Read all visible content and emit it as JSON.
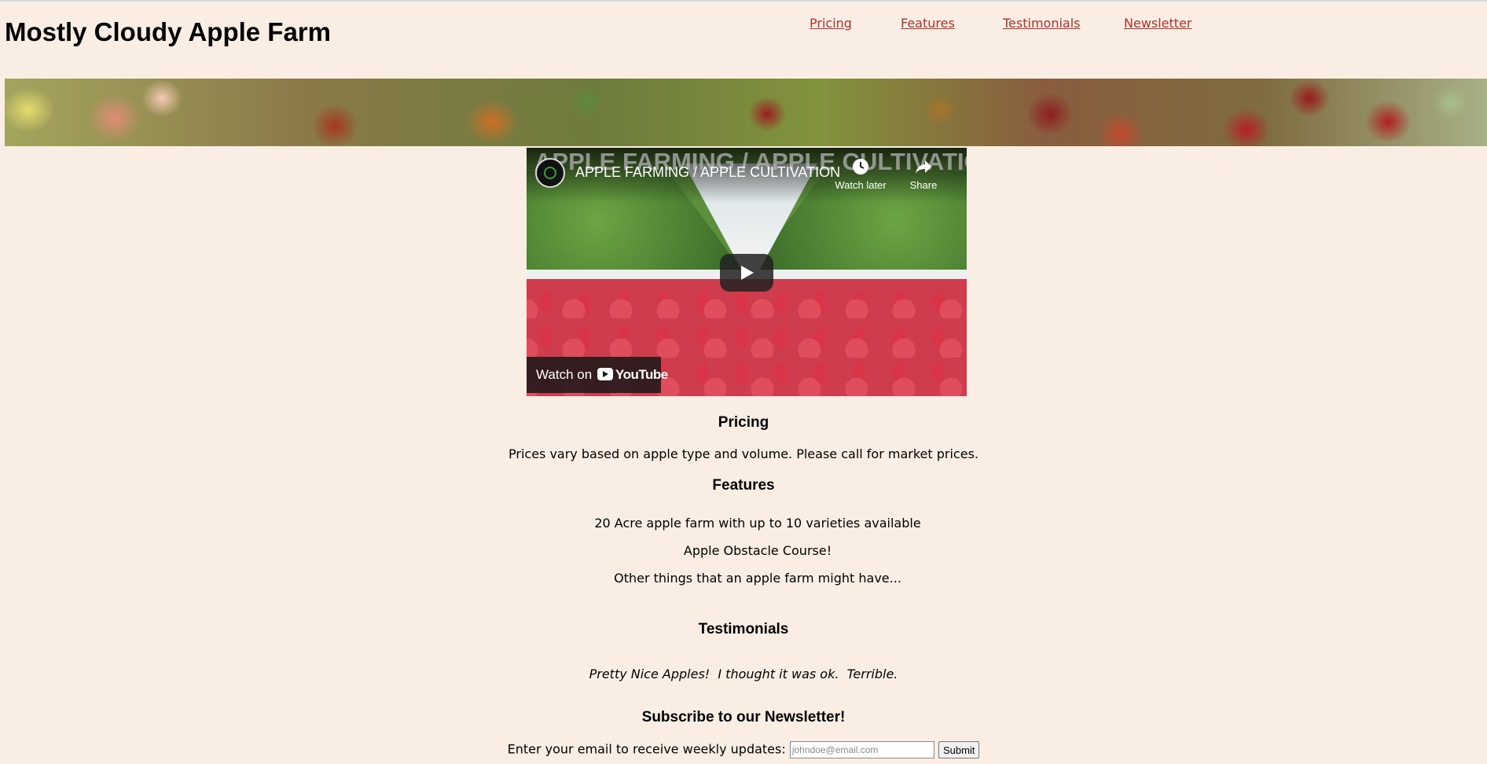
{
  "site": {
    "title": "Mostly Cloudy Apple Farm"
  },
  "nav": [
    {
      "label": "Pricing "
    },
    {
      "label": "Features "
    },
    {
      "label": "Testimonials "
    },
    {
      "label": "Newsletter"
    }
  ],
  "video": {
    "overlay_title": "APPLE FARMING / APPLE CULTIVATION",
    "title": "APPLE FARMING / APPLE CULTIVATION",
    "watch_later": "Watch later",
    "share": "Share",
    "watch_on": "Watch on",
    "youtube": "YouTube"
  },
  "pricing": {
    "heading": "Pricing",
    "text": "Prices vary based on apple type and volume. Please call for market prices."
  },
  "features": {
    "heading": "Features",
    "items": [
      "20 Acre apple farm with up to 10 varieties available",
      "Apple Obstacle Course!",
      "Other things that an apple farm might have..."
    ]
  },
  "testimonials": {
    "heading": "Testimonials",
    "quotes": [
      "Pretty Nice Apples!",
      "I thought it was ok.",
      "Terrible."
    ]
  },
  "newsletter": {
    "heading": "Subscribe to our Newsletter!",
    "label": "Enter your email to receive weekly updates:",
    "placeholder": "johndoe@email.com",
    "submit": "Submit"
  }
}
